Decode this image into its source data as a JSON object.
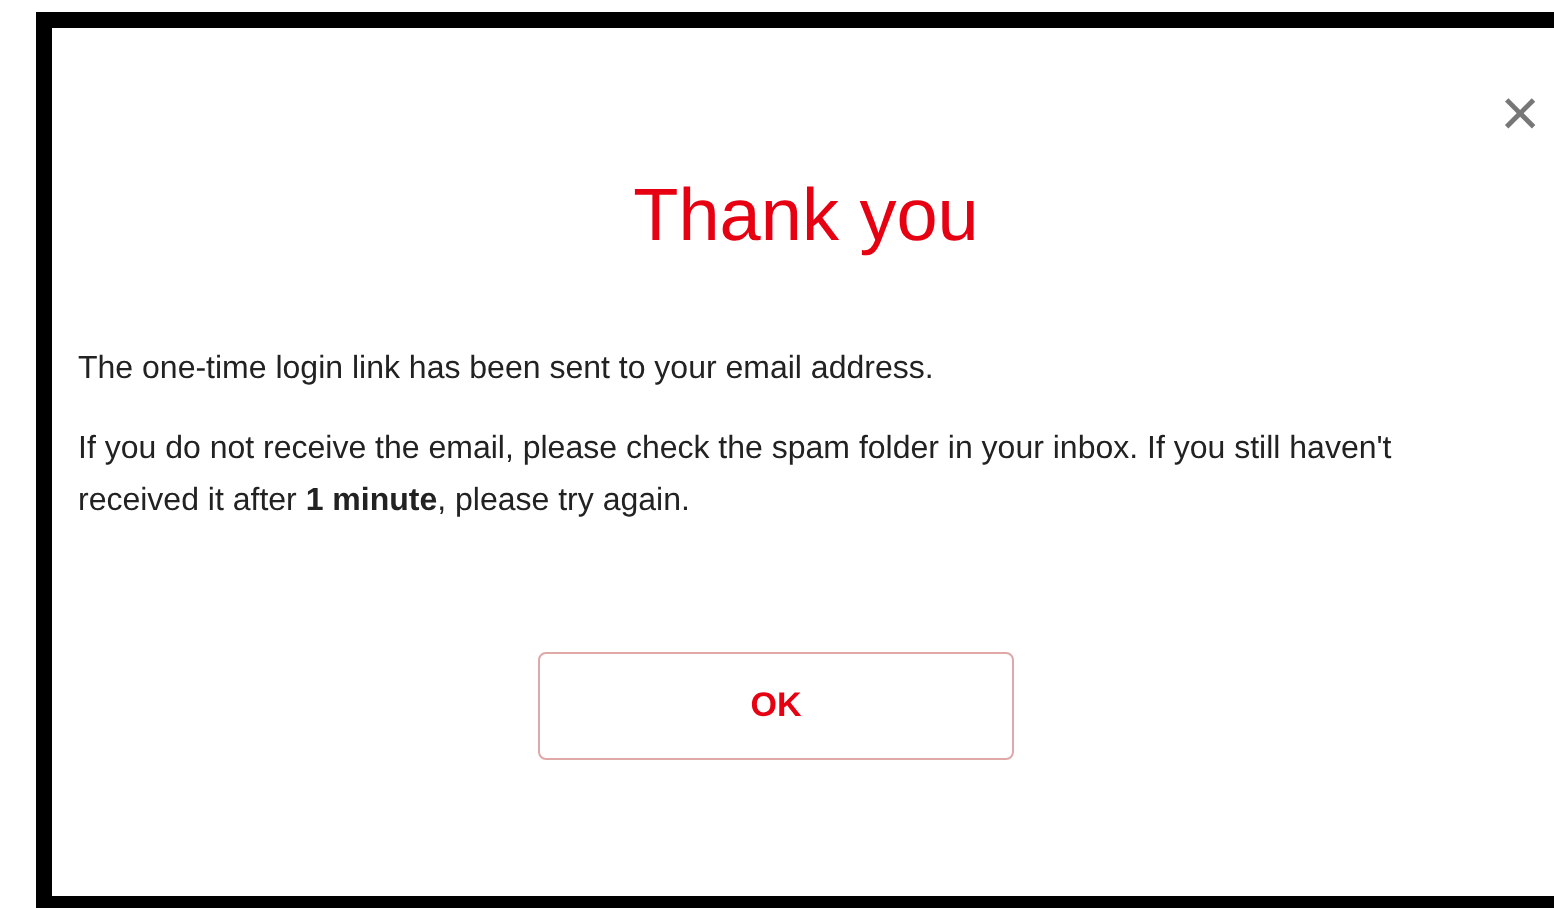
{
  "dialog": {
    "close": "×",
    "title": "Thank you",
    "paragraphs": [
      "The one-time login link has been sent to your email address.",
      "If you do not receive the email, please check the spam folder in your inbox. If you still haven't received it after **1 minute**, please try again."
    ],
    "button": "OK"
  }
}
